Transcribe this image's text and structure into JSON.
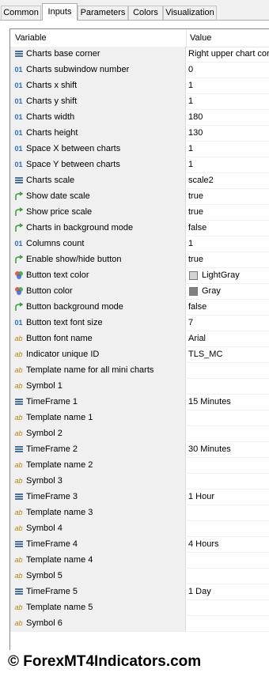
{
  "tabs": [
    {
      "label": "Common"
    },
    {
      "label": "Inputs"
    },
    {
      "label": "Parameters"
    },
    {
      "label": "Colors"
    },
    {
      "label": "Visualization"
    }
  ],
  "active_tab": "Inputs",
  "columns": {
    "variable": "Variable",
    "value": "Value"
  },
  "rows": [
    {
      "type": "enum",
      "name": "Charts base corner",
      "value": "Right upper chart corner"
    },
    {
      "type": "int",
      "name": "Charts subwindow number",
      "value": "0"
    },
    {
      "type": "int",
      "name": "Charts x shift",
      "value": "1"
    },
    {
      "type": "int",
      "name": "Charts y shift",
      "value": "1"
    },
    {
      "type": "int",
      "name": "Charts width",
      "value": "180"
    },
    {
      "type": "int",
      "name": "Charts height",
      "value": "130"
    },
    {
      "type": "int",
      "name": "Space X between charts",
      "value": "1"
    },
    {
      "type": "int",
      "name": "Space Y between charts",
      "value": "1"
    },
    {
      "type": "enum",
      "name": "Charts scale",
      "value": "scale2"
    },
    {
      "type": "bool",
      "name": "Show date scale",
      "value": "true"
    },
    {
      "type": "bool",
      "name": "Show price scale",
      "value": "true"
    },
    {
      "type": "bool",
      "name": "Charts in background mode",
      "value": "false"
    },
    {
      "type": "int",
      "name": "Columns count",
      "value": "1"
    },
    {
      "type": "bool",
      "name": "Enable show/hide button",
      "value": "true"
    },
    {
      "type": "color",
      "name": "Button text color",
      "value": "LightGray",
      "swatch": "#d3d3d3"
    },
    {
      "type": "color",
      "name": "Button color",
      "value": "Gray",
      "swatch": "#808080"
    },
    {
      "type": "bool",
      "name": "Button background mode",
      "value": "false"
    },
    {
      "type": "int",
      "name": "Button text font size",
      "value": "7"
    },
    {
      "type": "str",
      "name": "Button font name",
      "value": "Arial"
    },
    {
      "type": "str",
      "name": "Indicator unique ID",
      "value": "TLS_MC"
    },
    {
      "type": "str",
      "name": "Template name for all mini charts",
      "value": ""
    },
    {
      "type": "str",
      "name": "Symbol 1",
      "value": ""
    },
    {
      "type": "enum",
      "name": "TimeFrame 1",
      "value": "15 Minutes"
    },
    {
      "type": "str",
      "name": "Template name 1",
      "value": ""
    },
    {
      "type": "str",
      "name": "Symbol 2",
      "value": ""
    },
    {
      "type": "enum",
      "name": "TimeFrame 2",
      "value": "30 Minutes"
    },
    {
      "type": "str",
      "name": "Template name 2",
      "value": ""
    },
    {
      "type": "str",
      "name": "Symbol 3",
      "value": ""
    },
    {
      "type": "enum",
      "name": "TimeFrame 3",
      "value": "1 Hour"
    },
    {
      "type": "str",
      "name": "Template name 3",
      "value": ""
    },
    {
      "type": "str",
      "name": "Symbol 4",
      "value": ""
    },
    {
      "type": "enum",
      "name": "TimeFrame 4",
      "value": "4 Hours"
    },
    {
      "type": "str",
      "name": "Template name 4",
      "value": ""
    },
    {
      "type": "str",
      "name": "Symbol 5",
      "value": ""
    },
    {
      "type": "enum",
      "name": "TimeFrame 5",
      "value": "1 Day"
    },
    {
      "type": "str",
      "name": "Template name 5",
      "value": ""
    },
    {
      "type": "str",
      "name": "Symbol 6",
      "value": ""
    }
  ],
  "icons": {
    "int": "integer-icon",
    "str": "string-icon",
    "enum": "enumeration-icon",
    "bool": "boolean-icon",
    "color": "color-icon"
  },
  "icon_glyphs": {
    "int": "01",
    "str": "ab"
  },
  "colors": {
    "accent_int": "#2f6db3",
    "accent_str": "#b8860b",
    "bool_arrow": "#3a9a3a",
    "enum_icon": "#4a6f9a"
  },
  "watermark": "© ForexMT4Indicators.com"
}
